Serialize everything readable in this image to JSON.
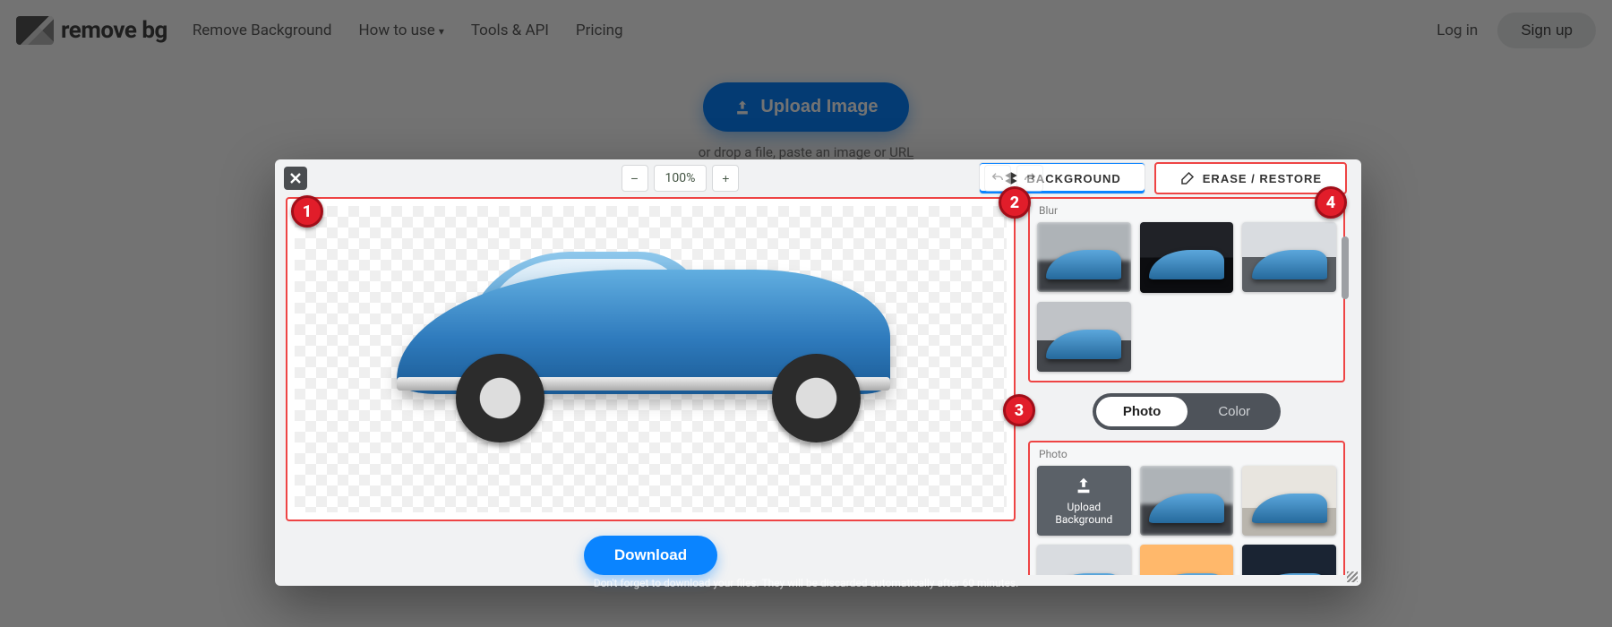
{
  "header": {
    "brand": "remove bg",
    "nav": {
      "remove_bg": "Remove Background",
      "how_to_use": "How to use",
      "tools_api": "Tools & API",
      "pricing": "Pricing"
    },
    "login": "Log in",
    "signup": "Sign up"
  },
  "hero": {
    "upload_label": "Upload Image",
    "hint_prefix": "or drop a file, paste an image or ",
    "hint_link": "URL"
  },
  "editor": {
    "zoom": "100%",
    "tabs": {
      "background": "BACKGROUND",
      "erase": "ERASE / RESTORE"
    },
    "download": "Download",
    "blur_title": "Blur",
    "photo_section_title": "Photo",
    "seg": {
      "photo": "Photo",
      "color": "Color"
    },
    "upload_bg_line1": "Upload",
    "upload_bg_line2": "Background"
  },
  "callouts": {
    "c1": "1",
    "c2": "2",
    "c3": "3",
    "c4": "4"
  },
  "footer_hint": "Don't forget to download your files. They will be discarded automatically after 60 minutes."
}
